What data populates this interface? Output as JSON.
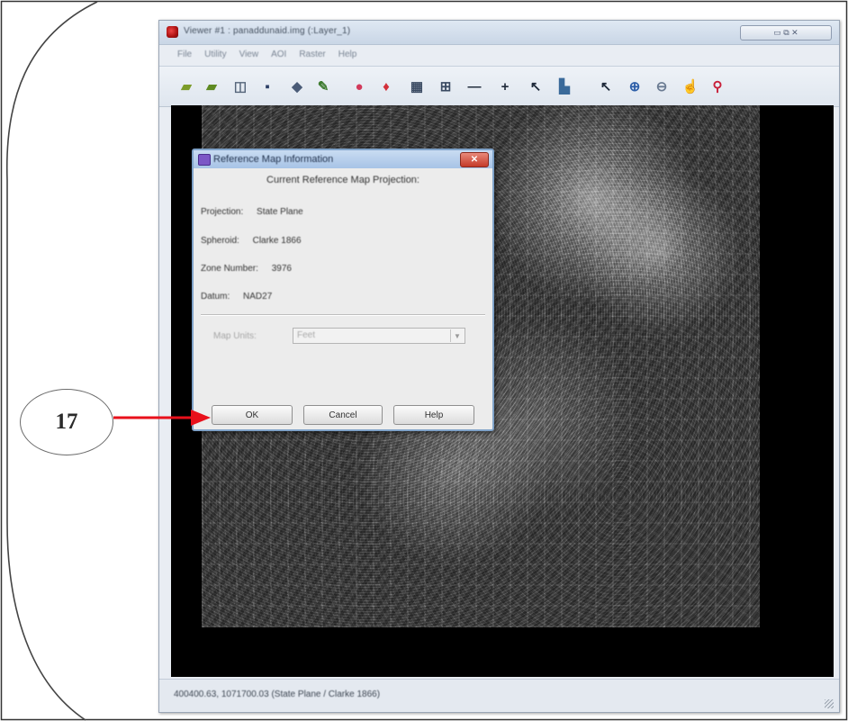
{
  "window": {
    "title": "Viewer #1 : panaddunaid.img (:Layer_1)",
    "controls": "▭  ⧉  ✕",
    "menu": [
      "File",
      "Utility",
      "View",
      "AOI",
      "Raster",
      "Help"
    ]
  },
  "toolbar": {
    "tools": [
      {
        "icon": "open-folder-icon",
        "glyph": "▰",
        "color": "#7c9c2a"
      },
      {
        "icon": "open-layer-icon",
        "glyph": "▰",
        "color": "#5e8a22"
      },
      {
        "icon": "clear-view-icon",
        "glyph": "◫",
        "color": "#55657a"
      },
      {
        "icon": "save-icon",
        "glyph": "▪",
        "color": "#2c3f66"
      },
      {
        "icon": "print-icon",
        "glyph": "◆",
        "color": "#4a5b77"
      },
      {
        "icon": "pencil-icon",
        "glyph": "✎",
        "color": "#3c7a2e"
      },
      {
        "icon": "info-icon",
        "glyph": "●",
        "color": "#d23a5b"
      },
      {
        "icon": "measure-icon",
        "glyph": "♦",
        "color": "#d2303a"
      },
      {
        "icon": "grid-icon",
        "glyph": "▦",
        "color": "#3a4a62"
      },
      {
        "icon": "fit-icon",
        "glyph": "⊞",
        "color": "#3a4a62"
      },
      {
        "icon": "zoom-out-icon",
        "glyph": "—",
        "color": "#1f2a3a"
      },
      {
        "icon": "zoom-in-icon",
        "glyph": "+",
        "color": "#1f2a3a"
      },
      {
        "icon": "pointer-tool-icon",
        "glyph": "↖",
        "color": "#1f2a3a"
      },
      {
        "icon": "chart-icon",
        "glyph": "▙",
        "color": "#3a6a9a"
      },
      {
        "icon": "select-arrow-icon",
        "glyph": "↖",
        "color": "#1f2a3a"
      },
      {
        "icon": "magnify-in-icon",
        "glyph": "⊕",
        "color": "#2d5fa8"
      },
      {
        "icon": "magnify-out-icon",
        "glyph": "⊖",
        "color": "#6a7b92"
      },
      {
        "icon": "hand-icon",
        "glyph": "☝",
        "color": "#4a4a4a"
      },
      {
        "icon": "inquire-icon",
        "glyph": "⚲",
        "color": "#c8203a"
      }
    ]
  },
  "status": {
    "text": "400400.63, 1071700.03   (State Plane / Clarke 1866)"
  },
  "dialog": {
    "title": "Reference Map Information",
    "close": "✕",
    "heading": "Current Reference Map Projection:",
    "rows": [
      {
        "label": "Projection:",
        "value": "State Plane"
      },
      {
        "label": "Spheroid:",
        "value": "Clarke 1866"
      },
      {
        "label": "Zone Number:",
        "value": "3976"
      },
      {
        "label": "Datum:",
        "value": "NAD27"
      }
    ],
    "units_label": "Map Units:",
    "units_value": "Feet",
    "buttons": {
      "ok": "OK",
      "cancel": "Cancel",
      "help": "Help"
    }
  },
  "callout": {
    "number": "17",
    "arrow_color": "#e8101b"
  }
}
